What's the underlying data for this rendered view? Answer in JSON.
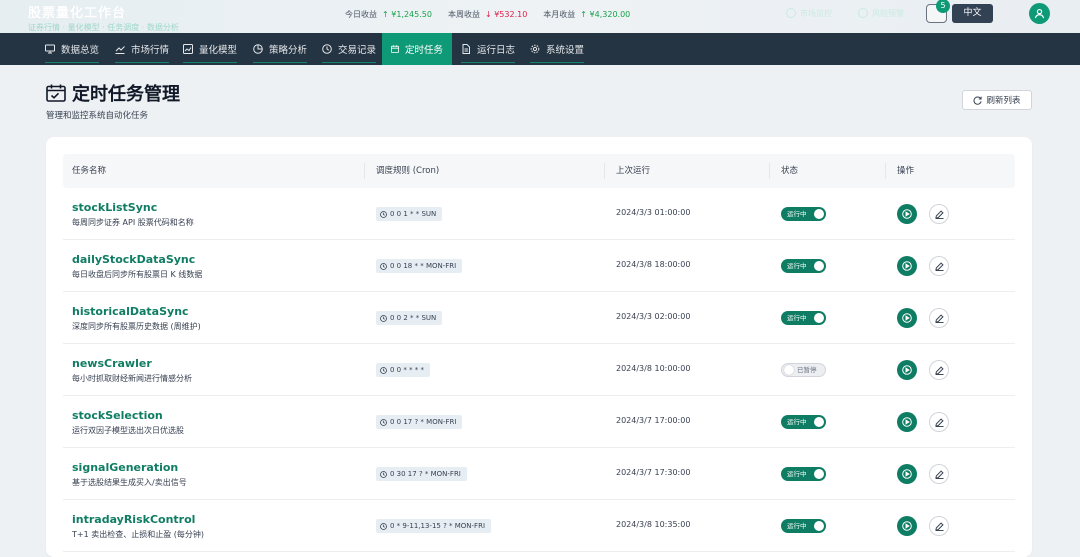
{
  "header": {
    "title": "股票量化工作台",
    "subtitle": "证券行情 · 量化模型 · 任务调度 · 数据分析",
    "stats": [
      {
        "label": "今日收益",
        "value": "↑ ¥1,245.50",
        "trend": "up"
      },
      {
        "label": "本周收益",
        "value": "↓ ¥532.10",
        "trend": "down"
      },
      {
        "label": "本月收益",
        "value": "↑ ¥4,320.00",
        "trend": "up"
      }
    ],
    "ghost_btn_1": "市场监控",
    "ghost_btn_2": "风险预警",
    "notification_count": "5",
    "language": "中文"
  },
  "nav": {
    "items": [
      {
        "label": "数据总览",
        "icon": "monitor-icon"
      },
      {
        "label": "市场行情",
        "icon": "trend-icon"
      },
      {
        "label": "量化模型",
        "icon": "chart-icon"
      },
      {
        "label": "策略分析",
        "icon": "pie-icon"
      },
      {
        "label": "交易记录",
        "icon": "history-icon"
      },
      {
        "label": "定时任务",
        "icon": "calendar-icon"
      },
      {
        "label": "运行日志",
        "icon": "file-icon"
      },
      {
        "label": "系统设置",
        "icon": "gear-icon"
      }
    ],
    "active": "定时任务"
  },
  "page": {
    "title": "定时任务管理",
    "subtitle": "管理和监控系统自动化任务",
    "refresh_label": "刷新列表"
  },
  "table": {
    "columns": [
      "任务名称",
      "调度规则 (Cron)",
      "上次运行",
      "状态",
      "操作"
    ],
    "rows": [
      {
        "name": "stockListSync",
        "desc": "每周同步证券 API 股票代码和名称",
        "cron": "0 0 1 * * SUN",
        "last_run": "2024/3/3 01:00:00",
        "status": "运行中",
        "enabled": true
      },
      {
        "name": "dailyStockDataSync",
        "desc": "每日收盘后同步所有股票日 K 线数据",
        "cron": "0 0 18 * * MON-FRI",
        "last_run": "2024/3/8 18:00:00",
        "status": "运行中",
        "enabled": true
      },
      {
        "name": "historicalDataSync",
        "desc": "深度同步所有股票历史数据 (周维护)",
        "cron": "0 0 2 * * SUN",
        "last_run": "2024/3/3 02:00:00",
        "status": "运行中",
        "enabled": true
      },
      {
        "name": "newsCrawler",
        "desc": "每小时抓取财经新闻进行情感分析",
        "cron": "0 0 * * * *",
        "last_run": "2024/3/8 10:00:00",
        "status": "已暂停",
        "enabled": false
      },
      {
        "name": "stockSelection",
        "desc": "运行双因子模型选出次日优选股",
        "cron": "0 0 17 ? * MON-FRI",
        "last_run": "2024/3/7 17:00:00",
        "status": "运行中",
        "enabled": true
      },
      {
        "name": "signalGeneration",
        "desc": "基于选股结果生成买入/卖出信号",
        "cron": "0 30 17 ? * MON-FRI",
        "last_run": "2024/3/7 17:30:00",
        "status": "运行中",
        "enabled": true
      },
      {
        "name": "intradayRiskControl",
        "desc": "T+1 卖出检查、止损和止盈 (每分钟)",
        "cron": "0 * 9-11,13-15 ? * MON-FRI",
        "last_run": "2024/3/8 10:35:00",
        "status": "运行中",
        "enabled": true
      }
    ]
  },
  "colors": {
    "accent": "#0f7d63",
    "nav_bg": "#253442",
    "nav_active": "#0f9a77",
    "up": "#16a34a",
    "down": "#e11d48"
  }
}
